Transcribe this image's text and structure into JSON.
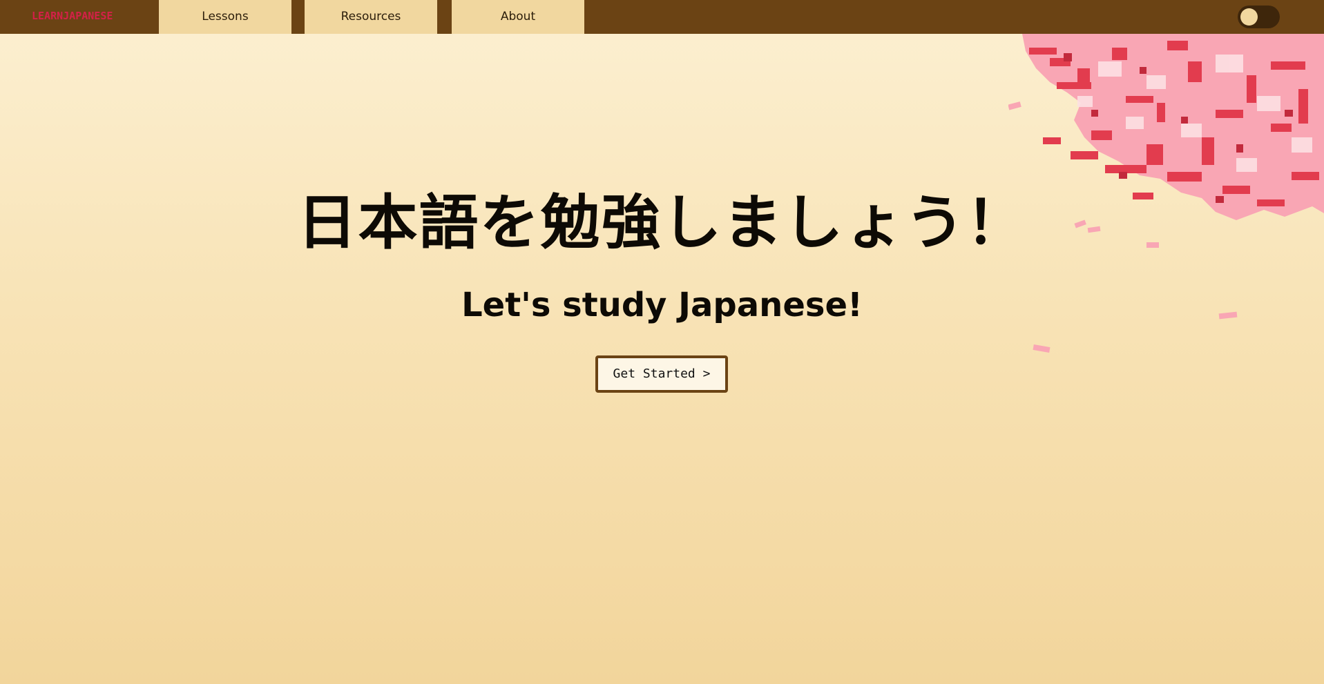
{
  "nav": {
    "logo": "LEARNJAPANESE",
    "tabs": [
      {
        "label": "Lessons"
      },
      {
        "label": "Resources"
      },
      {
        "label": "About"
      }
    ],
    "theme_toggle": {
      "state": "off"
    }
  },
  "hero": {
    "title_jp": "日本語を勉強しましょう！",
    "subtitle_en": "Let's study Japanese!",
    "cta_label": "Get Started >"
  },
  "colors": {
    "nav_bg": "#6b4314",
    "tab_bg": "#f1d79f",
    "logo": "#d42048",
    "page_bg_top": "#fcf0d2",
    "page_bg_bottom": "#f2d59b",
    "blossom_pink": "#f9a6b4",
    "blossom_red": "#e23c4e"
  },
  "decor": {
    "illustration": "cherry-blossom-branch"
  }
}
